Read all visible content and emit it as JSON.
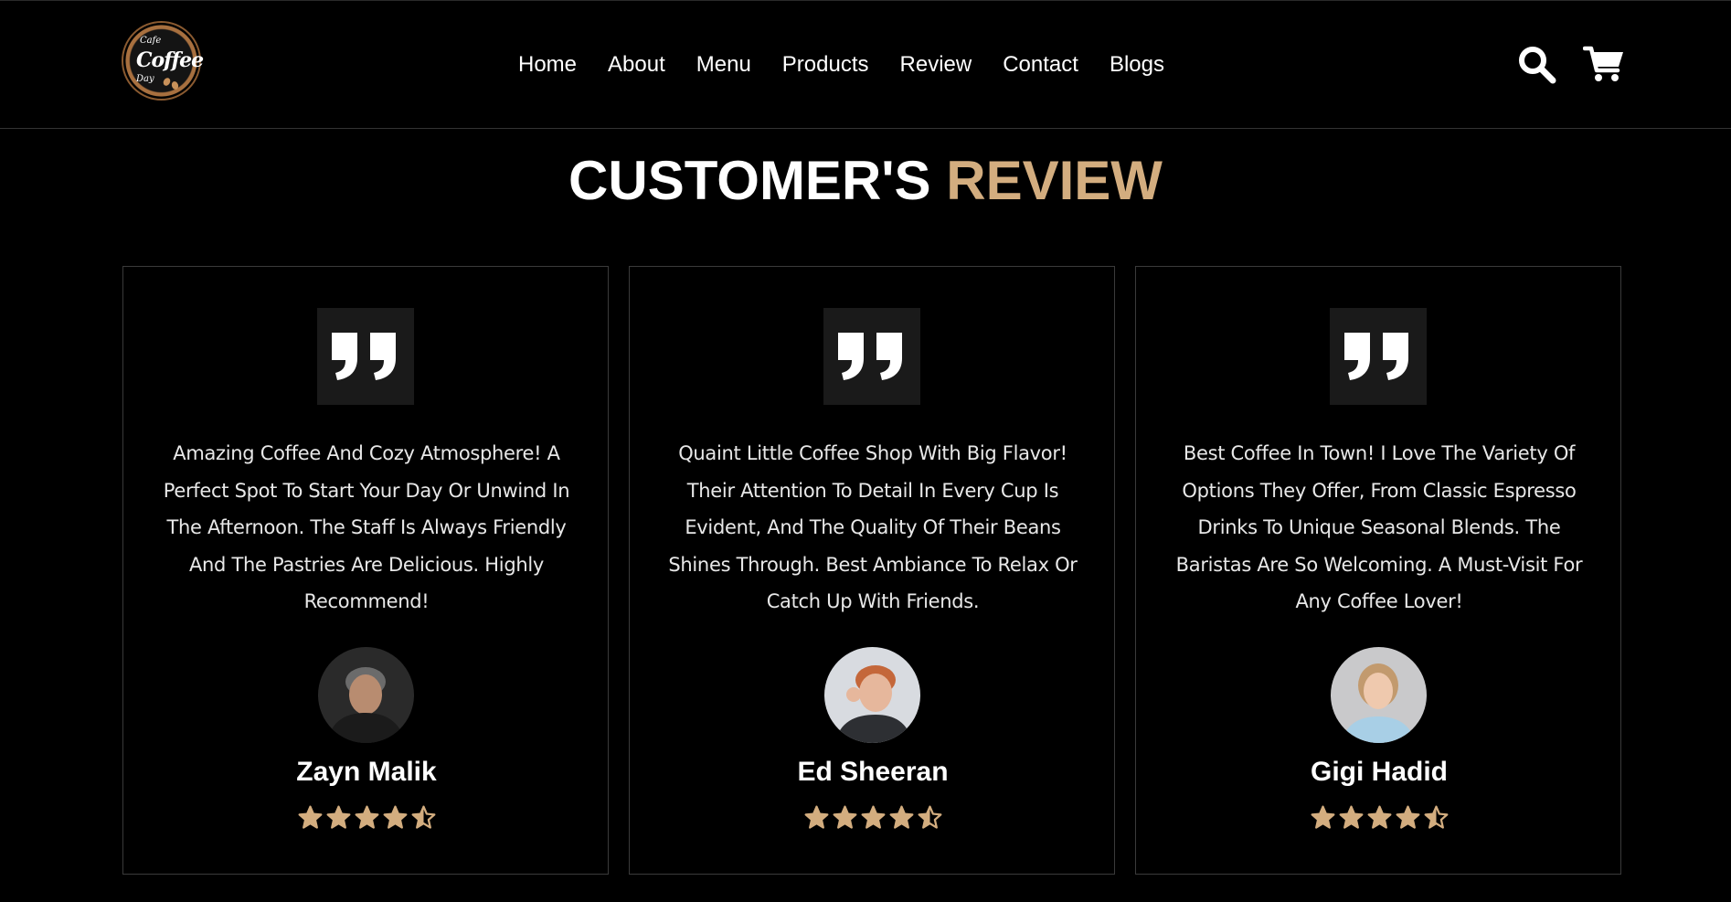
{
  "brand": {
    "logo_small_text": "Cafe",
    "logo_main_text": "Coffee",
    "logo_sub_text": "Day"
  },
  "nav": {
    "items": [
      "Home",
      "About",
      "Menu",
      "Products",
      "Review",
      "Contact",
      "Blogs"
    ]
  },
  "icons": {
    "search": "search-icon",
    "cart": "cart-icon",
    "quote": "quote-icon",
    "star": "star-icon"
  },
  "section": {
    "title_main": "CUSTOMER'S",
    "title_accent": "REVIEW",
    "accent_color": "#d3ad7f"
  },
  "reviews": [
    {
      "text": "Amazing Coffee And Cozy Atmosphere! A Perfect Spot To Start Your Day Or Unwind In The Afternoon. The Staff Is Always Friendly And The Pastries Are Delicious. Highly Recommend!",
      "name": "Zayn Malik",
      "rating": 4.5
    },
    {
      "text": "Quaint Little Coffee Shop With Big Flavor! Their Attention To Detail In Every Cup Is Evident, And The Quality Of Their Beans Shines Through. Best Ambiance To Relax Or Catch Up With Friends.",
      "name": "Ed Sheeran",
      "rating": 4.5
    },
    {
      "text": "Best Coffee In Town! I Love The Variety Of Options They Offer, From Classic Espresso Drinks To Unique Seasonal Blends. The Baristas Are So Welcoming. A Must-Visit For Any Coffee Lover!",
      "name": "Gigi Hadid",
      "rating": 4.5
    }
  ]
}
